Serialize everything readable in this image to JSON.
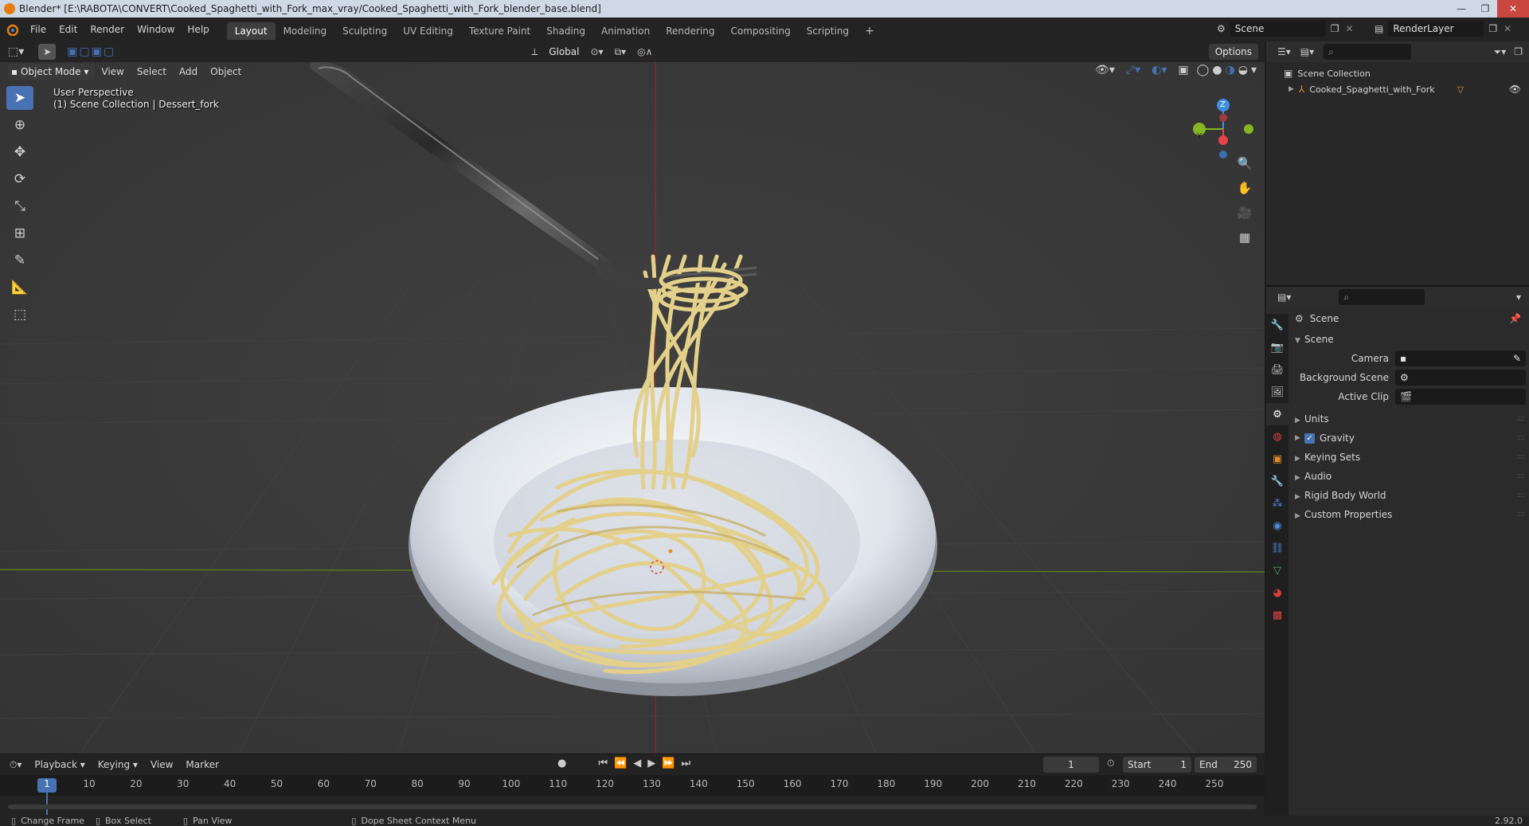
{
  "window": {
    "title": "Blender* [E:\\RABOTA\\CONVERT\\Cooked_Spaghetti_with_Fork_max_vray/Cooked_Spaghetti_with_Fork_blender_base.blend]",
    "minimize": "—",
    "maximize": "❐",
    "close": "✕"
  },
  "menu": {
    "file": "File",
    "edit": "Edit",
    "render": "Render",
    "window": "Window",
    "help": "Help"
  },
  "workspaces": [
    "Layout",
    "Modeling",
    "Sculpting",
    "UV Editing",
    "Texture Paint",
    "Shading",
    "Animation",
    "Rendering",
    "Compositing",
    "Scripting"
  ],
  "workspace_add": "+",
  "scene_field": "Scene",
  "renderlayer_field": "RenderLayer",
  "viewport": {
    "orientation": "Global",
    "options_label": "Options",
    "mode": "Object Mode",
    "view_menu": "View",
    "select_menu": "Select",
    "add_menu": "Add",
    "object_menu": "Object",
    "perspective_label": "User Perspective",
    "collection_label": "(1) Scene Collection | Dessert_fork",
    "gizmo": {
      "z": "Z",
      "y": "Y"
    }
  },
  "outliner": {
    "root": "Scene Collection",
    "items": [
      {
        "label": "Cooked_Spaghetti_with_Fork"
      }
    ]
  },
  "properties": {
    "context_label": "Scene",
    "section": "Scene",
    "fields": [
      {
        "label": "Camera",
        "value": ""
      },
      {
        "label": "Background Scene",
        "value": ""
      },
      {
        "label": "Active Clip",
        "value": ""
      }
    ],
    "panels": [
      {
        "label": "Units",
        "checkbox": false
      },
      {
        "label": "Gravity",
        "checkbox": true
      },
      {
        "label": "Keying Sets",
        "checkbox": false
      },
      {
        "label": "Audio",
        "checkbox": false
      },
      {
        "label": "Rigid Body World",
        "checkbox": false
      },
      {
        "label": "Custom Properties",
        "checkbox": false
      }
    ]
  },
  "timeline": {
    "playback": "Playback",
    "keying": "Keying",
    "view": "View",
    "marker": "Marker",
    "current_frame": "1",
    "start_label": "Start",
    "start_value": "1",
    "end_label": "End",
    "end_value": "250",
    "ticks": [
      "1",
      "10",
      "20",
      "30",
      "40",
      "50",
      "60",
      "70",
      "80",
      "90",
      "100",
      "110",
      "120",
      "130",
      "140",
      "150",
      "160",
      "170",
      "180",
      "190",
      "200",
      "210",
      "220",
      "230",
      "240",
      "250"
    ]
  },
  "statusbar": {
    "change_frame": "Change Frame",
    "box_select": "Box Select",
    "pan_view": "Pan View",
    "context_menu": "Dope Sheet Context Menu",
    "version": "2.92.0"
  },
  "colors": {
    "accent": "#4772b3",
    "viewport_bg": "#393939",
    "spaghetti": "#e3d08a",
    "plate": "#dfe4ec",
    "axis_x": "#e8434c",
    "axis_y": "#86b622",
    "axis_z": "#3d8fe0"
  }
}
